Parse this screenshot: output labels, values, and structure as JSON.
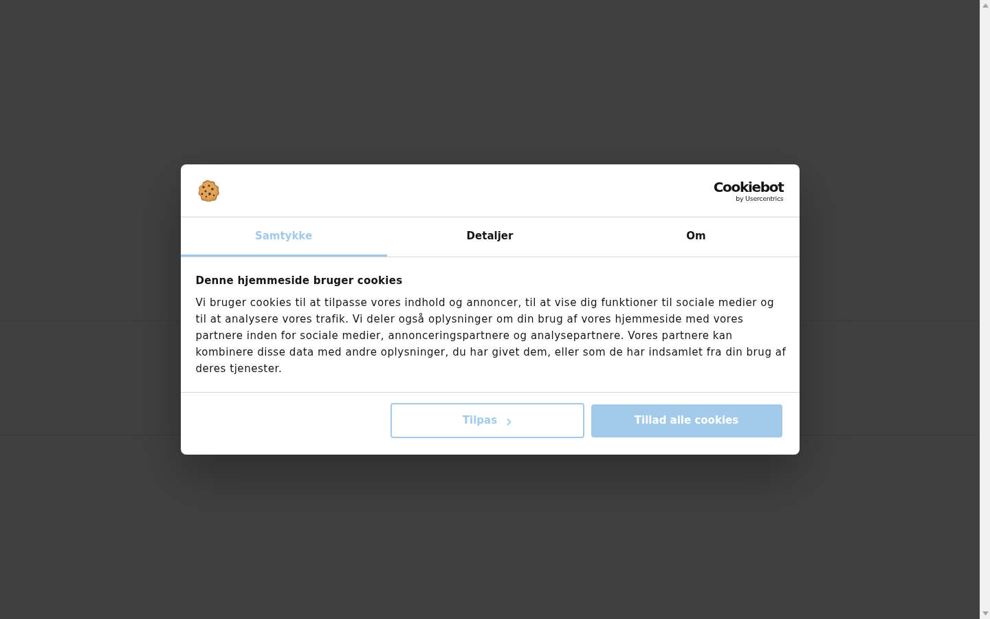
{
  "dialog": {
    "logo": {
      "wordmark": "Cookiebot",
      "tagline": "by Usercentrics"
    },
    "tabs": [
      {
        "label": "Samtykke",
        "selected": true
      },
      {
        "label": "Detaljer",
        "selected": false
      },
      {
        "label": "Om",
        "selected": false
      }
    ],
    "heading": "Denne hjemmeside bruger cookies",
    "body": "Vi bruger cookies til at tilpasse vores indhold og annoncer, til at vise dig funktioner til sociale medier og til at analysere vores trafik. Vi deler også oplysninger om din brug af vores hjemmeside med vores partnere inden for sociale medier, annonceringspartnere og analysepartnere. Vores partnere kan kombinere disse data med andre oplysninger, du har givet dem, eller som de har indsamlet fra din brug af deres tjenester.",
    "buttons": [
      {
        "kind": "customize",
        "label": "Tilpas"
      },
      {
        "kind": "accept",
        "label": "Tillad alle cookies"
      }
    ]
  }
}
